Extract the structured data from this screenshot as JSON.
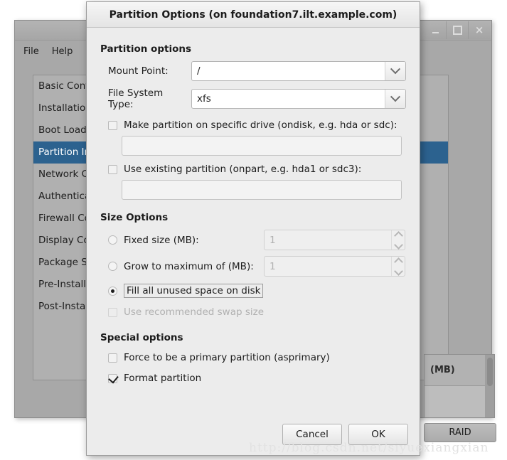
{
  "background_window": {
    "menu": [
      "File",
      "Help"
    ],
    "window_buttons": [
      {
        "name": "minimize",
        "glyph": "_"
      },
      {
        "name": "maximize",
        "glyph": "□"
      },
      {
        "name": "close",
        "glyph": "×"
      }
    ],
    "list_items": [
      {
        "label": "Basic Configuration",
        "selected": false
      },
      {
        "label": "Installation Method",
        "selected": false
      },
      {
        "label": "Boot Loader Options",
        "selected": false
      },
      {
        "label": "Partition Information",
        "selected": true
      },
      {
        "label": "Network Configuration",
        "selected": false
      },
      {
        "label": "Authentication",
        "selected": false
      },
      {
        "label": "Firewall Configuration",
        "selected": false
      },
      {
        "label": "Display Configuration",
        "selected": false
      },
      {
        "label": "Package Selection",
        "selected": false
      },
      {
        "label": "Pre-Installation Script",
        "selected": false
      },
      {
        "label": "Post-Installation Script",
        "selected": false
      }
    ],
    "table_header": "(MB)",
    "raid_button": "RAID",
    "selection_color": "#2c628f"
  },
  "dialog": {
    "title": "Partition Options (on foundation7.ilt.example.com)",
    "partition_options": {
      "heading": "Partition options",
      "mount_point_label": "Mount Point:",
      "mount_point_value": "/",
      "file_system_type_label": "File System Type:",
      "file_system_type_value": "xfs",
      "ondisk_checkbox_label": "Make partition on specific drive (ondisk, e.g. hda or sdc):",
      "ondisk_checked": false,
      "ondisk_value": "",
      "onpart_checkbox_label": "Use existing partition (onpart, e.g. hda1 or sdc3):",
      "onpart_checked": false,
      "onpart_value": ""
    },
    "size_options": {
      "heading": "Size Options",
      "fixed_size_label": "Fixed size (MB):",
      "fixed_size_value": "1",
      "fixed_size_selected": false,
      "grow_max_label": "Grow to maximum of (MB):",
      "grow_max_value": "1",
      "grow_max_selected": false,
      "fill_label": "Fill all unused space on disk",
      "fill_selected": true,
      "swap_label": "Use recommended swap size",
      "swap_checked": false,
      "swap_disabled": true
    },
    "special_options": {
      "heading": "Special options",
      "asprimary_label": "Force to be a primary partition (asprimary)",
      "asprimary_checked": false,
      "format_label": "Format partition",
      "format_checked": true
    },
    "buttons": {
      "cancel": "Cancel",
      "ok": "OK"
    }
  },
  "watermark": "http://blog.csdn.net/siyuexiangxian"
}
